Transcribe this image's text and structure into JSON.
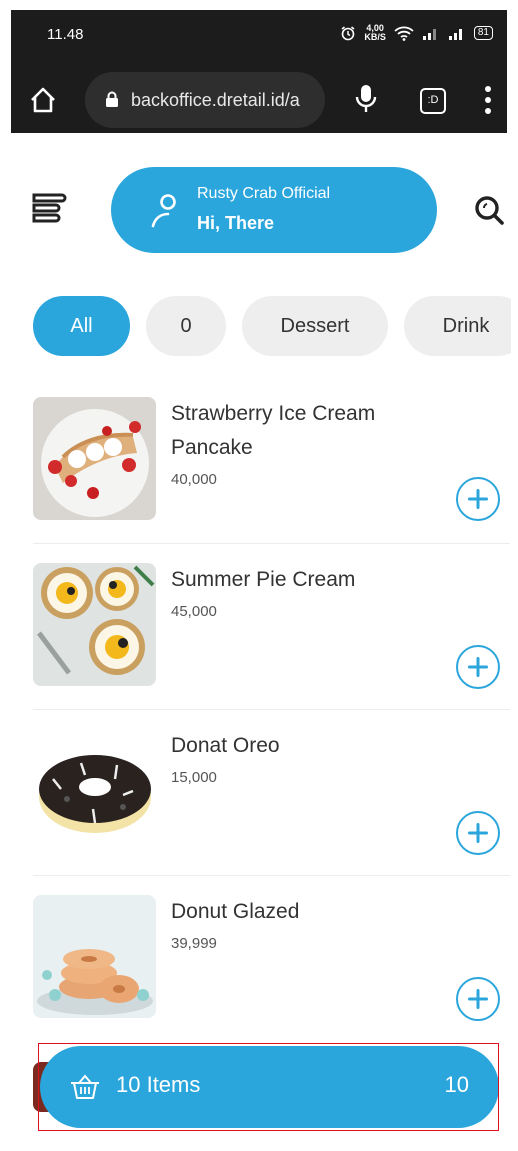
{
  "status_bar": {
    "time": "11.48",
    "net_speed_value": "4,00",
    "net_speed_unit": "KB/S",
    "battery": "81"
  },
  "browser": {
    "url": "backoffice.dretail.id/a",
    "tab_count": ":D"
  },
  "header": {
    "shop_name": "Rusty Crab Official",
    "greeting": "Hi, There"
  },
  "categories": [
    {
      "label": "All",
      "active": true
    },
    {
      "label": "0",
      "active": false
    },
    {
      "label": "Dessert",
      "active": false
    },
    {
      "label": "Drink",
      "active": false
    }
  ],
  "products": [
    {
      "name": "Strawberry Ice Cream Pancake",
      "price": "40,000"
    },
    {
      "name": "Summer Pie Cream",
      "price": "45,000"
    },
    {
      "name": "Donat Oreo",
      "price": "15,000"
    },
    {
      "name": "Donut Glazed",
      "price": "39,999"
    }
  ],
  "cart": {
    "label": "10 Items",
    "count": "10"
  },
  "colors": {
    "accent": "#2aa6dc",
    "chip_bg": "#eeeeee",
    "chrome_bg": "#1c1c1c"
  },
  "icons": [
    "home-icon",
    "lock-icon",
    "mic-icon",
    "tabs-icon",
    "more-icon",
    "menu-icon",
    "user-icon",
    "search-icon",
    "plus-icon",
    "basket-icon"
  ]
}
